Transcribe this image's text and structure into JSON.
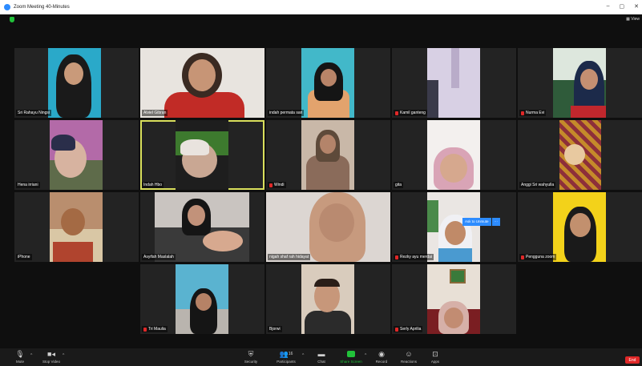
{
  "window": {
    "title": "Zoom Meeting 40-Minutes"
  },
  "tiles": [
    {
      "name": "Sri Rahayu Ningsi",
      "muted": false
    },
    {
      "name": "Alviel Gibran",
      "muted": false
    },
    {
      "name": "indah permata sari",
      "muted": false
    },
    {
      "name": "Kamil ganteng",
      "muted": true
    },
    {
      "name": "Nurma Evi",
      "muted": true
    },
    {
      "name": "Hena irriani",
      "muted": false
    },
    {
      "name": "Indah Hbo",
      "muted": false,
      "active": true
    },
    {
      "name": "Windi",
      "muted": true
    },
    {
      "name": "gita",
      "muted": false
    },
    {
      "name": "Anggi Sri wahyulla",
      "muted": false
    },
    {
      "name": "iPhone",
      "muted": false
    },
    {
      "name": "Asyifah Maslalah",
      "muted": false
    },
    {
      "name": "nigah shaf rah hidayat",
      "muted": false
    },
    {
      "name": "Rezky ayu merdai",
      "muted": true
    },
    {
      "name": "Pengguna zoom",
      "muted": true
    },
    {
      "name": "Tri Maulia",
      "muted": true
    },
    {
      "name": "Bjorwi",
      "muted": false
    },
    {
      "name": "Serly Aprilia",
      "muted": true
    }
  ],
  "ask_to_unmute": "Ask to Unmute",
  "toolbar": {
    "mute": "Mute",
    "stop_video": "Stop Video",
    "security": "Security",
    "participants": "Participants",
    "participants_count": "16",
    "chat": "Chat",
    "share_screen": "Share Screen",
    "record": "Record",
    "reactions": "Reactions",
    "apps": "Apps",
    "end": "End"
  },
  "view_label": "View"
}
